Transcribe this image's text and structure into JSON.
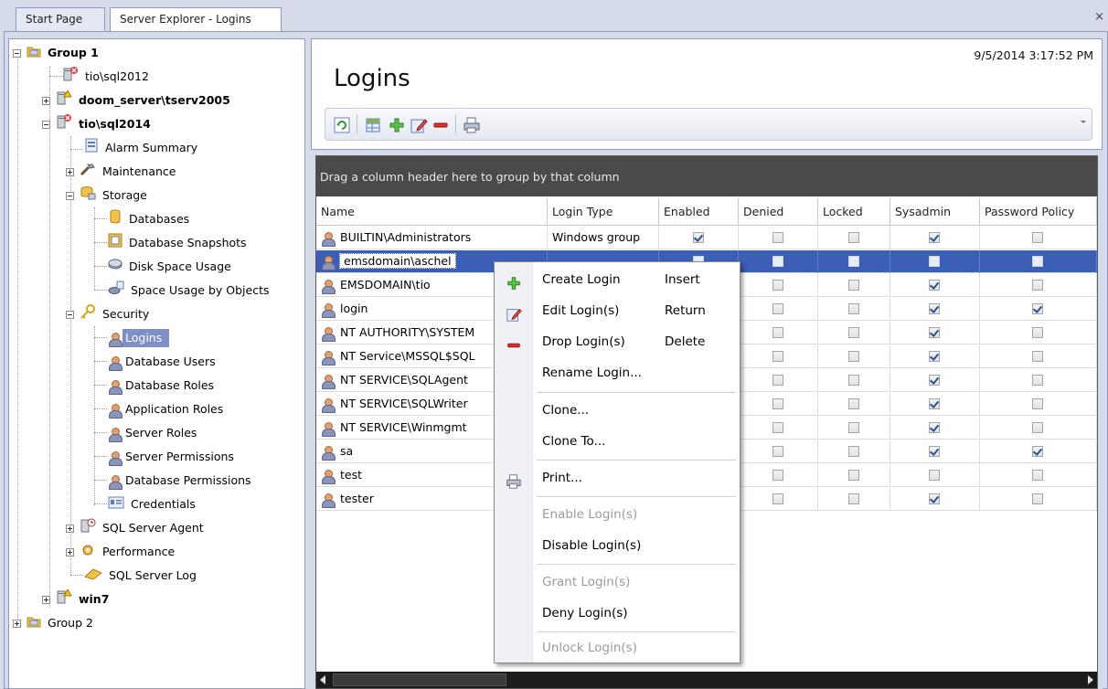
{
  "tabs": [
    {
      "label": "Start Page"
    },
    {
      "label": "Server Explorer - Logins"
    }
  ],
  "tab_close": "×",
  "tree": {
    "group1": "Group 1",
    "tio_sql2012": "tio\\sql2012",
    "doom_server": "doom_server\\tserv2005",
    "tio_sql2014": "tio\\sql2014",
    "alarm_summary": "Alarm Summary",
    "maintenance": "Maintenance",
    "storage": "Storage",
    "databases": "Databases",
    "database_snapshots": "Database Snapshots",
    "disk_space_usage": "Disk Space Usage",
    "space_usage_by_objects": "Space Usage by Objects",
    "security": "Security",
    "logins": "Logins",
    "database_users": "Database Users",
    "database_roles": "Database Roles",
    "application_roles": "Application Roles",
    "server_roles": "Server Roles",
    "server_permissions": "Server Permissions",
    "database_permissions": "Database Permissions",
    "credentials": "Credentials",
    "sql_server_agent": "SQL Server Agent",
    "performance": "Performance",
    "sql_server_log": "SQL Server Log",
    "win7": "win7",
    "group2": "Group 2"
  },
  "header": {
    "title": "Logins",
    "timestamp": "9/5/2014 3:17:52 PM"
  },
  "grid": {
    "group_hint": "Drag a column header here to group by that column",
    "columns": [
      "Name",
      "Login Type",
      "Enabled",
      "Denied",
      "Locked",
      "Sysadmin",
      "Password Policy"
    ],
    "rows": [
      {
        "name": "BUILTIN\\Administrators",
        "type": "Windows group",
        "enabled": true,
        "denied": false,
        "locked": false,
        "sysadmin": true,
        "policy": false
      },
      {
        "name": "emsdomain\\aschel",
        "type": "",
        "enabled": false,
        "denied": false,
        "locked": false,
        "sysadmin": false,
        "policy": false
      },
      {
        "name": "EMSDOMAIN\\tio",
        "type": "",
        "enabled": false,
        "denied": false,
        "locked": false,
        "sysadmin": true,
        "policy": false
      },
      {
        "name": "login",
        "type": "",
        "enabled": false,
        "denied": false,
        "locked": false,
        "sysadmin": true,
        "policy": true
      },
      {
        "name": "NT AUTHORITY\\SYSTEM",
        "type": "",
        "enabled": false,
        "denied": false,
        "locked": false,
        "sysadmin": true,
        "policy": false
      },
      {
        "name": "NT Service\\MSSQL$SQL",
        "type": "",
        "enabled": false,
        "denied": false,
        "locked": false,
        "sysadmin": true,
        "policy": false
      },
      {
        "name": "NT SERVICE\\SQLAgent",
        "type": "",
        "enabled": false,
        "denied": false,
        "locked": false,
        "sysadmin": true,
        "policy": false
      },
      {
        "name": "NT SERVICE\\SQLWriter",
        "type": "",
        "enabled": false,
        "denied": false,
        "locked": false,
        "sysadmin": true,
        "policy": false
      },
      {
        "name": "NT SERVICE\\Winmgmt",
        "type": "",
        "enabled": false,
        "denied": false,
        "locked": false,
        "sysadmin": true,
        "policy": false
      },
      {
        "name": "sa",
        "type": "",
        "enabled": false,
        "denied": false,
        "locked": false,
        "sysadmin": true,
        "policy": true
      },
      {
        "name": "test",
        "type": "",
        "enabled": false,
        "denied": false,
        "locked": false,
        "sysadmin": false,
        "policy": false
      },
      {
        "name": "tester",
        "type": "",
        "enabled": false,
        "denied": false,
        "locked": false,
        "sysadmin": true,
        "policy": false
      }
    ]
  },
  "menu": {
    "create": "Create Login",
    "create_key": "Insert",
    "edit": "Edit Login(s)",
    "edit_key": "Return",
    "drop": "Drop Login(s)",
    "drop_key": "Delete",
    "rename": "Rename Login...",
    "clone": "Clone...",
    "clone_to": "Clone To...",
    "print": "Print...",
    "enable": "Enable Login(s)",
    "disable": "Disable Login(s)",
    "grant": "Grant Login(s)",
    "deny": "Deny Login(s)",
    "unlock": "Unlock Login(s)"
  },
  "colors": {
    "selection": "#3a5fb4",
    "tree_selection": "#7f8fc8",
    "group_bar": "#4a4a4a"
  }
}
